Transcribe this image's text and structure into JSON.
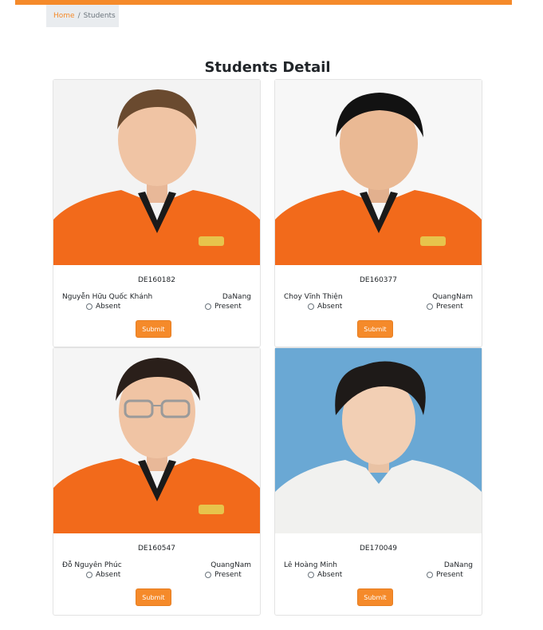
{
  "breadcrumb": {
    "home": "Home",
    "separator": "/",
    "current": "Students"
  },
  "page": {
    "title": "Students Detail"
  },
  "labels": {
    "absent": "Absent",
    "present": "Present",
    "submit": "Submit"
  },
  "colors": {
    "accent": "#f58a2a",
    "shirt_orange": "#f26a1b",
    "photo_bg_light": "#f4f4f4",
    "photo_bg_blue": "#6aa8d4"
  },
  "students": [
    {
      "id": "DE160182",
      "name": "Nguyễn Hữu Quốc Khánh",
      "location": "DaNang"
    },
    {
      "id": "DE160377",
      "name": "Choy Vĩnh Thiện",
      "location": "QuangNam"
    },
    {
      "id": "DE160547",
      "name": "Đỗ Nguyên Phúc",
      "location": "QuangNam"
    },
    {
      "id": "DE170049",
      "name": "Lê Hoàng Minh",
      "location": "DaNang"
    }
  ]
}
